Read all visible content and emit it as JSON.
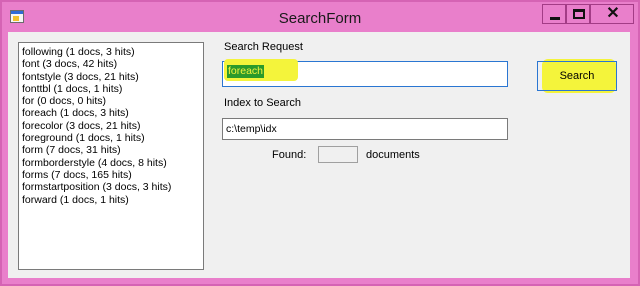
{
  "window": {
    "title": "SearchForm",
    "close_glyph": "✕",
    "icons": {
      "app": "form-app-icon",
      "minimize": "minimize-icon",
      "maximize": "maximize-icon",
      "close": "close-icon"
    }
  },
  "results": {
    "items": [
      "following (1 docs, 3 hits)",
      "font (3 docs, 42 hits)",
      "fontstyle (3 docs, 21 hits)",
      "fonttbl (1 docs, 1 hits)",
      "for (0 docs, 0 hits)",
      "foreach (1 docs, 3 hits)",
      "forecolor (3 docs, 21 hits)",
      "foreground (1 docs, 1 hits)",
      "form (7 docs, 31 hits)",
      "formborderstyle (4 docs, 8 hits)",
      "forms (7 docs, 165 hits)",
      "formstartposition (3 docs, 3 hits)",
      "forward (1 docs, 1 hits)"
    ]
  },
  "search": {
    "label": "Search Request",
    "value": "foreach",
    "button_label": "Search"
  },
  "index": {
    "label": "Index to Search",
    "value": "c:\\temp\\idx"
  },
  "found": {
    "label": "Found:",
    "value": "",
    "suffix": "documents"
  },
  "colors": {
    "window_frame": "#e97fcb",
    "client_bg": "#f0f0f0",
    "highlight": "#f4f43b",
    "selection_bg": "#2b9a2b",
    "focus_border": "#2a76d2"
  }
}
